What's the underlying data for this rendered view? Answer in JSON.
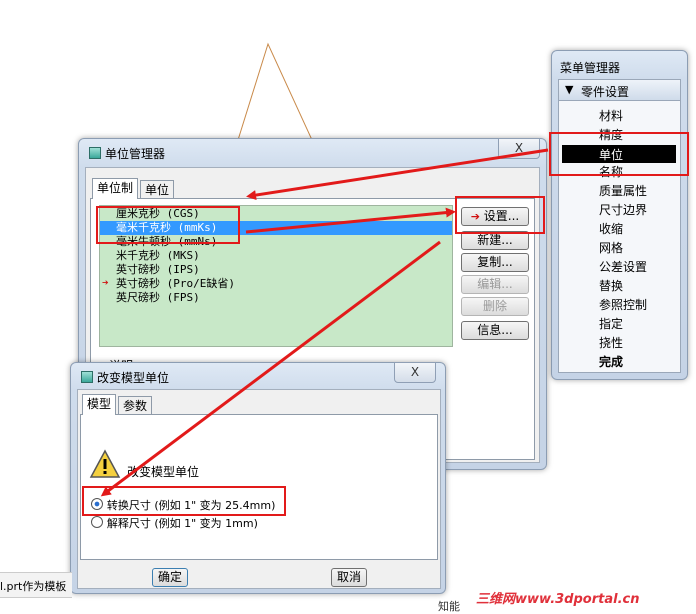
{
  "menu_manager": {
    "title": "菜单管理器",
    "section": "零件设置",
    "items": [
      "材料",
      "精度",
      "单位",
      "名称",
      "质量属性",
      "尺寸边界",
      "收缩",
      "网格",
      "公差设置",
      "替换",
      "参照控制",
      "指定",
      "挠性",
      "完成"
    ],
    "selected_index": 2
  },
  "units_manager": {
    "title": "单位管理器",
    "close": "X",
    "tabs": [
      "单位制",
      "单位"
    ],
    "systems": [
      "厘米克秒 (CGS)",
      "毫米千克秒 (mmKs)",
      "毫米牛顿秒 (mmNs)",
      "米千克秒 (MKS)",
      "英寸磅秒 (IPS)",
      "英寸磅秒 (Pro/E缺省)",
      "英尺磅秒 (FPS)"
    ],
    "selected_index": 1,
    "current_index": 5,
    "buttons": [
      "设置...",
      "新建...",
      "复制...",
      "编辑...",
      "删除",
      "信息..."
    ],
    "description_label": "说明"
  },
  "change_units": {
    "title": "改变模型单位",
    "tabs": [
      "模型",
      "参数"
    ],
    "heading": "改变模型单位",
    "options": [
      "转换尺寸 (例如 1\" 变为 25.4mm)",
      "解释尺寸 (例如 1\" 变为 1mm)"
    ],
    "selected_option": 0,
    "ok": "确定",
    "cancel": "取消"
  },
  "background": {
    "file_tip": "l.prt作为模板",
    "watermark": "三维网www.3dportal.cn",
    "bottom_text": "知能"
  },
  "colors": {
    "accent_red": "#e21a1a",
    "selection": "#3399ff",
    "list_green": "#c8e8c8",
    "watermark": "#e0303a"
  }
}
